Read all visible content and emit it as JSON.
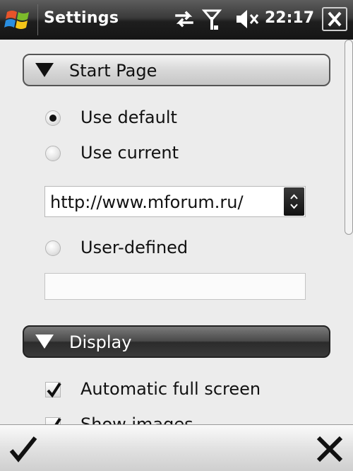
{
  "titlebar": {
    "app_title": "Settings",
    "clock": "22:17",
    "icons": [
      "windows-start-icon",
      "data-sync-icon",
      "signal-antenna-icon",
      "volume-muted-icon",
      "close-icon"
    ]
  },
  "sections": {
    "start_page": {
      "title": "Start Page",
      "options": [
        {
          "label": "Use default",
          "checked": true
        },
        {
          "label": "Use current",
          "checked": false
        },
        {
          "label": "User-defined",
          "checked": false
        }
      ],
      "current_url": "http://www.mforum.ru/",
      "user_defined_value": ""
    },
    "display": {
      "title": "Display",
      "options": [
        {
          "label": "Automatic full screen",
          "checked": true
        },
        {
          "label": "Show images",
          "checked": true
        }
      ]
    }
  },
  "softkeys": {
    "ok_icon": "checkmark-icon",
    "cancel_icon": "close-x-icon"
  },
  "colors": {
    "titlebar_bg": "#1e1e1e",
    "content_bg": "#ececec",
    "header_dark": "#3a3a3a"
  }
}
